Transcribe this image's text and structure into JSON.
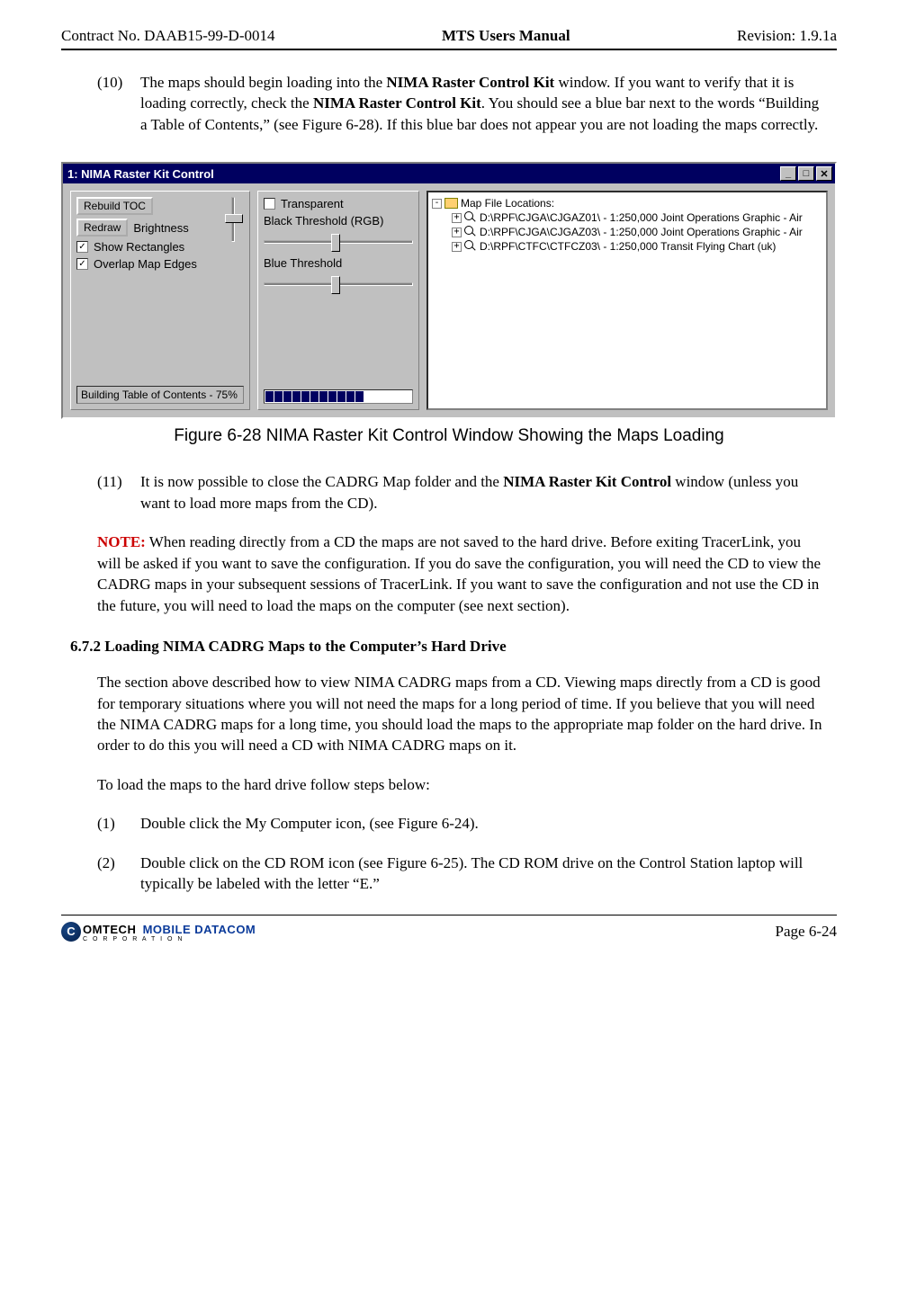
{
  "header": {
    "contract": "Contract No. DAAB15-99-D-0014",
    "title": "MTS Users Manual",
    "revision": "Revision:  1.9.1a"
  },
  "para10": {
    "num": "(10)",
    "t1": "The maps should begin loading into the ",
    "b1": "NIMA Raster Control Kit",
    "t2": " window.  If you want to verify that it is loading correctly, check the ",
    "b2": "NIMA Raster Control Kit",
    "t3": ".  You should see a blue bar next to the words “Building a Table of Contents,” (see Figure 6-28).  If this blue bar does not appear you are not loading the maps correctly."
  },
  "window": {
    "title": "1: NIMA Raster Kit Control",
    "btn_min": "_",
    "btn_max": "□",
    "btn_close": "✕",
    "rebuild": "Rebuild TOC",
    "redraw": "Redraw",
    "brightness": "Brightness",
    "show_rect": "Show Rectangles",
    "overlap": "Overlap Map Edges",
    "status": "Building Table of Contents - 75%",
    "transparent": "Transparent",
    "black_thresh": "Black Threshold (RGB)",
    "blue_thresh": "Blue Threshold",
    "tree_root": "Map File Locations:",
    "tree1": "D:\\RPF\\CJGA\\CJGAZ01\\ - 1:250,000 Joint Operations Graphic - Air",
    "tree2": "D:\\RPF\\CJGA\\CJGAZ03\\ - 1:250,000 Joint Operations Graphic - Air",
    "tree3": "D:\\RPF\\CTFC\\CTFCZ03\\ - 1:250,000 Transit Flying Chart (uk)"
  },
  "figcaption": "Figure 6-28   NIMA Raster Kit Control Window Showing the Maps Loading",
  "para11": {
    "num": "(11)",
    "t1": "It is now possible to close the CADRG Map folder and the ",
    "b1": "NIMA Raster Kit Control",
    "t2": " window (unless you want to load more maps from the CD)."
  },
  "note": {
    "label": "NOTE:",
    "text": "  When reading directly from a CD the maps are not saved to the hard drive.  Before exiting TracerLink, you will be asked if you want to save the configuration.  If you do save the configuration, you will need the CD to view the CADRG maps in your subsequent sessions of TracerLink.  If you want to save the configuration and not use the CD in the future, you will need to load the maps on the computer (see next section)."
  },
  "section": {
    "num": "6.7.2",
    "title": "  Loading NIMA CADRG Maps to the Computer’s Hard Drive"
  },
  "sec_para": "The section above described how to view NIMA CADRG maps from a CD.  Viewing maps directly from a CD is good for temporary situations where you will not need the maps for a long period of time.  If you believe that you will need the NIMA CADRG maps for a long time, you should load the maps to the appropriate map folder on the hard drive.  In order to do this you will need a CD with NIMA CADRG maps on it.",
  "steps_intro": "To load the maps to the hard drive follow steps below:",
  "step1": {
    "num": "(1)",
    "text": "Double click the My Computer icon, (see Figure 6-24)."
  },
  "step2": {
    "num": "(2)",
    "text": "Double click on the CD ROM icon (see Figure 6-25).  The CD ROM drive on the Control Station laptop will typically be labeled with the letter “E.”"
  },
  "footer": {
    "logo_c": "C",
    "logo_omtech": "OMTECH",
    "logo_md": "MOBILE DATACOM",
    "logo_corp": "C O R P O R A T I O N",
    "page": "Page 6-24"
  }
}
